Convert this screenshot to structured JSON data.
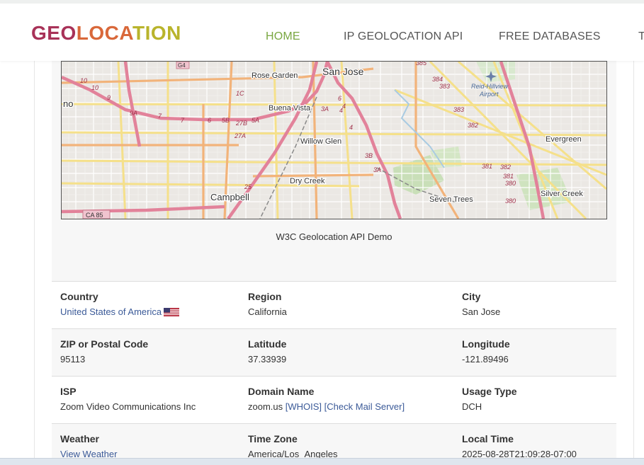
{
  "header": {
    "logo": {
      "part1": "GEO",
      "part2": "LOCA",
      "part3": "TION"
    },
    "nav": [
      {
        "label": "HOME",
        "active": true
      },
      {
        "label": "IP GEOLOCATION API",
        "active": false
      },
      {
        "label": "FREE DATABASES",
        "active": false
      },
      {
        "label": "T",
        "active": false
      }
    ]
  },
  "map": {
    "caption": "W3C Geolocation API Demo",
    "labels": {
      "san_jose": "San Jose",
      "rose_garden": "Rose Garden",
      "buena_vista": "Buena Vista",
      "willow_glen": "Willow Glen",
      "dry_creek": "Dry Creek",
      "campbell": "Campbell",
      "seven_trees": "Seven Trees",
      "evergreen": "Evergreen",
      "silver_creek": "Silver Creek",
      "airport": "Reid-Hillview\nAirport",
      "airport_line1": "Reid-Hillview",
      "airport_line2": "Airport",
      "no": "no",
      "ca85": "CA 85",
      "g4": "G4"
    },
    "exits": [
      "10",
      "10",
      "9",
      "9A",
      "7",
      "7",
      "6",
      "5B",
      "5A",
      "27B",
      "27A",
      "1C",
      "3A",
      "4",
      "6",
      "4",
      "4",
      "3B",
      "3A",
      "25",
      "385",
      "384",
      "383",
      "383",
      "382",
      "381",
      "382",
      "381",
      "380",
      "380"
    ]
  },
  "info": {
    "rows": [
      [
        {
          "label": "Country",
          "value": "United States of America",
          "link": true,
          "flag": true
        },
        {
          "label": "Region",
          "value": "California"
        },
        {
          "label": "City",
          "value": "San Jose"
        }
      ],
      [
        {
          "label": "ZIP or Postal Code",
          "value": "95113"
        },
        {
          "label": "Latitude",
          "value": "37.33939"
        },
        {
          "label": "Longitude",
          "value": "-121.89496"
        }
      ],
      [
        {
          "label": "ISP",
          "value": "Zoom Video Communications Inc"
        },
        {
          "label": "Domain Name",
          "value": "zoom.us",
          "links": [
            "[WHOIS]",
            "[Check Mail Server]"
          ]
        },
        {
          "label": "Usage Type",
          "value": "DCH"
        }
      ],
      [
        {
          "label": "Weather",
          "value": "View Weather",
          "link": true
        },
        {
          "label": "Time Zone",
          "value": "America/Los_Angeles"
        },
        {
          "label": "Local Time",
          "value": "2025-08-28T21:09:28-07:00"
        }
      ]
    ]
  },
  "colors": {
    "logo_red": "#a83258",
    "logo_orange": "#d9683a",
    "logo_olive": "#b9b42c",
    "nav_active": "#7aa741",
    "link": "#3b5a98"
  }
}
